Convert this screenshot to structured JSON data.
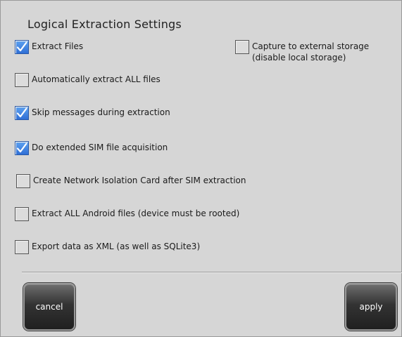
{
  "panel": {
    "title": "Logical Extraction Settings"
  },
  "options": [
    {
      "label": "Extract Files",
      "checked": true
    },
    {
      "label": "Capture to external storage\n(disable local storage)",
      "checked": false
    },
    {
      "label": "Automatically extract ALL files",
      "checked": false
    },
    {
      "label": "Skip messages during extraction",
      "checked": true
    },
    {
      "label": "Do extended SIM file acquisition",
      "checked": true
    },
    {
      "label": "Create Network Isolation Card after SIM extraction",
      "checked": false
    },
    {
      "label": "Extract ALL Android files (device must be rooted)",
      "checked": false
    },
    {
      "label": "Export data as XML (as well as SQLite3)",
      "checked": false
    }
  ],
  "buttons": {
    "cancel": "cancel",
    "apply": "apply"
  },
  "colors": {
    "checked": "#2f6fd6",
    "background": "#d6d6d6",
    "button": "#2b2b2b"
  }
}
